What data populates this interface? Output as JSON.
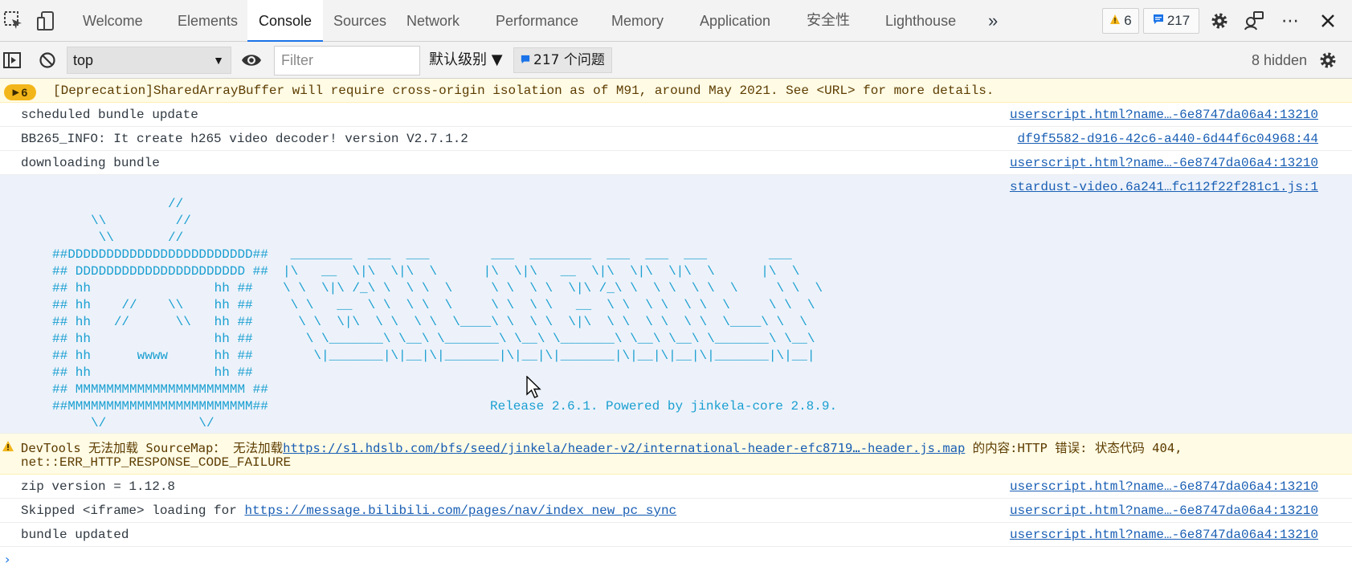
{
  "tabs": {
    "welcome": "Welcome",
    "elements": "Elements",
    "console": "Console",
    "sources": "Sources",
    "network": "Network",
    "performance": "Performance",
    "memory": "Memory",
    "application": "Application",
    "security": "安全性",
    "lighthouse": "Lighthouse",
    "more": "»"
  },
  "status": {
    "warnings": "6",
    "messages": "217"
  },
  "toolbar": {
    "context": "top",
    "filter_placeholder": "Filter",
    "levels": "默认级别 ▼",
    "issues": "217 个问题",
    "hidden": "8 hidden"
  },
  "messages": {
    "deprecation": {
      "count": "6",
      "text": "[Deprecation]SharedArrayBuffer will require cross-origin isolation as of M91, around May 2021. See <URL> for more details."
    },
    "m1": {
      "text": "scheduled bundle update",
      "source": "userscript.html?name…-6e8747da06a4:13210"
    },
    "m2": {
      "text": "BB265_INFO: It create h265 video decoder! version V2.7.1.2",
      "source": "df9f5582-d916-42c6-a440-6d44f6c04968:44"
    },
    "m3": {
      "text": "downloading bundle",
      "source": "userscript.html?name…-6e8747da06a4:13210"
    },
    "banner": {
      "source": "stardust-video.6a241…fc112f22f281c1.js:1",
      "tv": [
        "               //",
        "     \\\\         //",
        "      \\\\       //",
        "##DDDDDDDDDDDDDDDDDDDDDDDD##",
        "## DDDDDDDDDDDDDDDDDDDDDD ##",
        "## hh                hh ##",
        "## hh    //    \\\\    hh ##",
        "## hh   //      \\\\   hh ##",
        "## hh                hh ##",
        "## hh      wwww      hh ##",
        "## hh                hh ##",
        "## MMMMMMMMMMMMMMMMMMMMMM ##",
        "##MMMMMMMMMMMMMMMMMMMMMMMM##",
        "     \\/            \\/"
      ],
      "logo": [
        " ________  ___  ___        ___  ________  ___  ___  ___        ___",
        "|\\   __  \\|\\  \\|\\  \\      |\\  \\|\\   __  \\|\\  \\|\\  \\|\\  \\      |\\  \\",
        "\\ \\  \\|\\ /_\\ \\  \\ \\  \\     \\ \\  \\ \\  \\|\\ /_\\ \\  \\ \\  \\ \\  \\     \\ \\  \\",
        " \\ \\   __  \\ \\  \\ \\  \\     \\ \\  \\ \\   __  \\ \\  \\ \\  \\ \\  \\     \\ \\  \\",
        "  \\ \\  \\|\\  \\ \\  \\ \\  \\____\\ \\  \\ \\  \\|\\  \\ \\  \\ \\  \\ \\  \\____\\ \\  \\",
        "   \\ \\_______\\ \\__\\ \\_______\\ \\__\\ \\_______\\ \\__\\ \\__\\ \\_______\\ \\__\\",
        "    \\|_______|\\|__|\\|_______|\\|__|\\|_______|\\|__|\\|__|\\|_______|\\|__|"
      ],
      "release": "Release 2.6.1. Powered by jinkela-core 2.8.9."
    },
    "sourcemap": {
      "prefix": "DevTools 无法加载 SourceMap： 无法加载",
      "link": "https://s1.hdslb.com/bfs/seed/jinkela/header-v2/international-header-efc8719…-header.js.map",
      "suffix": " 的内容:HTTP 错误: 状态代码 404,",
      "line2": "net::ERR_HTTP_RESPONSE_CODE_FAILURE"
    },
    "m5": {
      "text": "zip version = 1.12.8",
      "source": "userscript.html?name…-6e8747da06a4:13210"
    },
    "m6": {
      "text": "Skipped <iframe> loading for ",
      "link": "https://message.bilibili.com/pages/nav/index_new_pc_sync",
      "source": "userscript.html?name…-6e8747da06a4:13210"
    },
    "m7": {
      "text": "bundle updated",
      "source": "userscript.html?name…-6e8747da06a4:13210"
    },
    "prompt": "›"
  },
  "colors": {
    "accent": "#1a73e8",
    "warning_bg": "#fffbe5",
    "warning_badge": "#f3b61a",
    "link": "#1a5fb4",
    "ascii": "#1a9fd1"
  }
}
